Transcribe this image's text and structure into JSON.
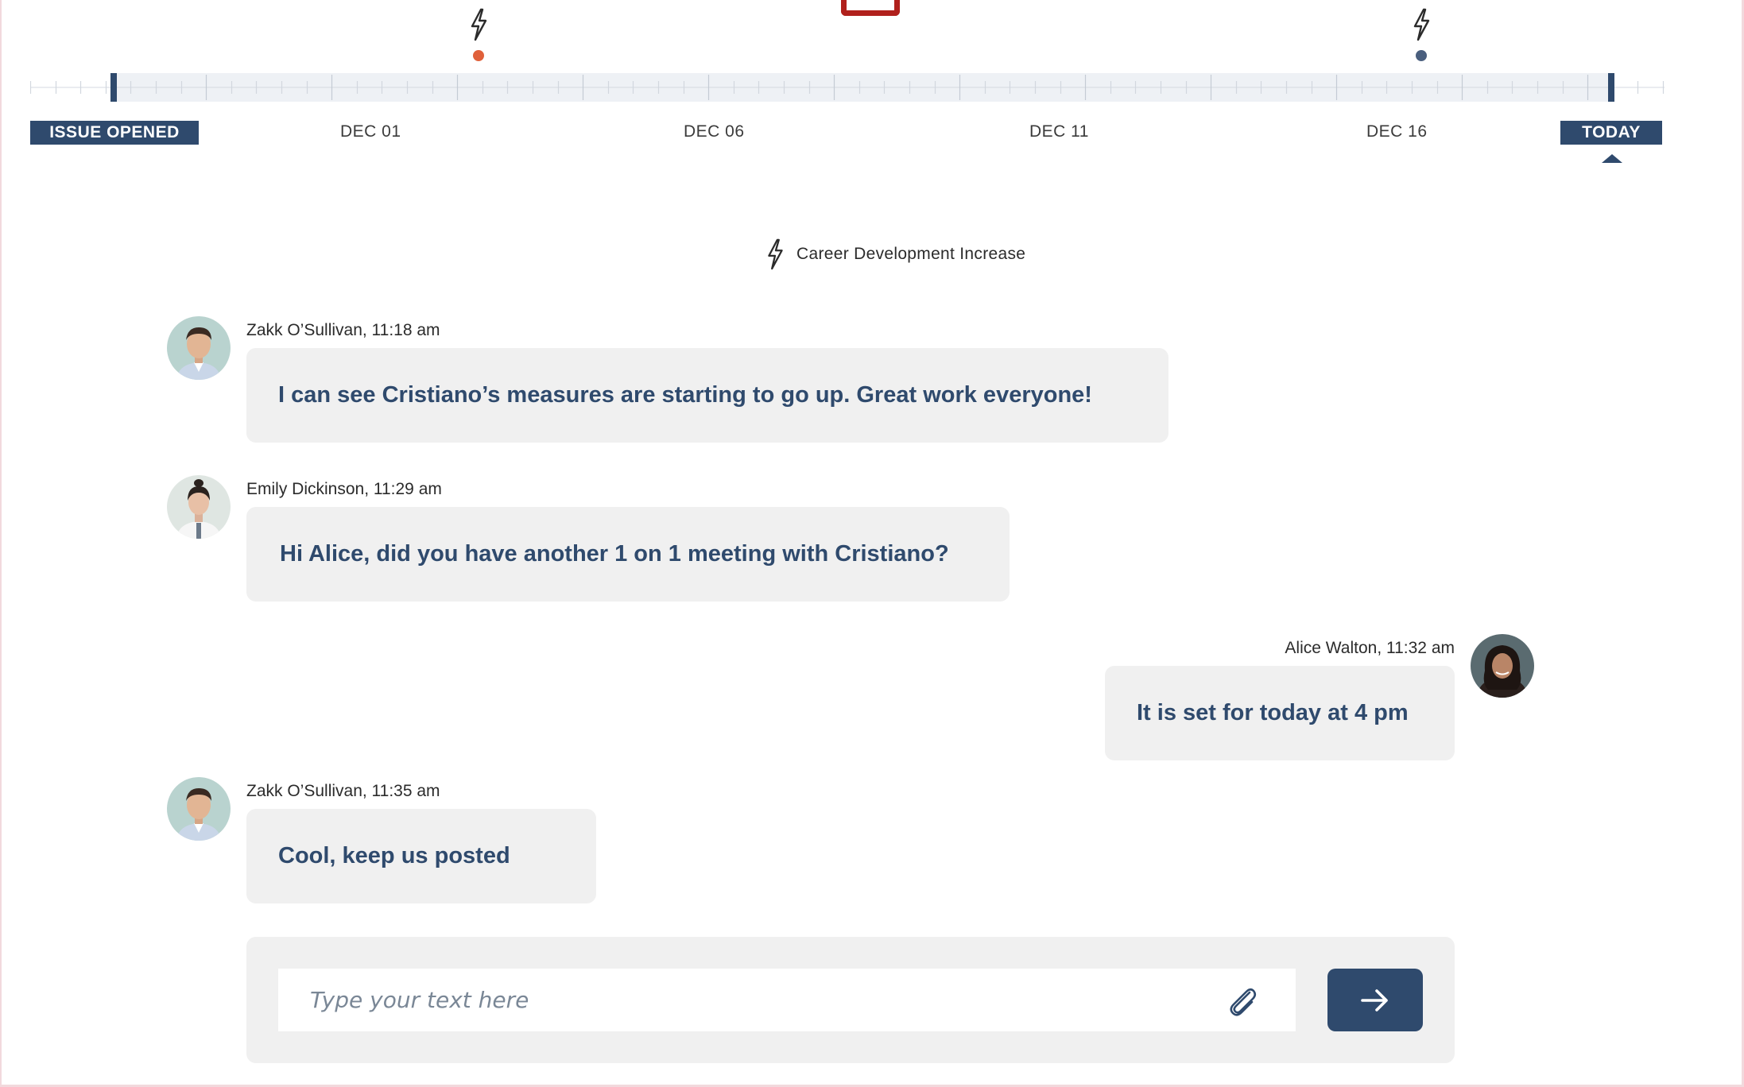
{
  "timeline": {
    "start_badge": "ISSUE OPENED",
    "end_badge": "TODAY",
    "dates": [
      "DEC 01",
      "DEC 06",
      "DEC 11",
      "DEC 16"
    ],
    "events": [
      {
        "icon": "bolt-icon",
        "color": "#e0603a"
      },
      {
        "icon": "bolt-icon",
        "color": "#4a5f7e"
      }
    ]
  },
  "event_heading": {
    "icon": "bolt-icon",
    "label": "Career Development Increase"
  },
  "messages": [
    {
      "author": "Zakk O’Sullivan, 11:18 am",
      "text": "I can see Cristiano’s measures are starting to go up. Great work everyone!",
      "side": "left"
    },
    {
      "author": "Emily Dickinson, 11:29 am",
      "text": "Hi Alice, did you have another 1 on 1 meeting with Cristiano?",
      "side": "left"
    },
    {
      "author": "Alice Walton, 11:32 am",
      "text": "It is set for today at 4 pm",
      "side": "right"
    },
    {
      "author": "Zakk O’Sullivan, 11:35 am",
      "text": "Cool, keep us posted",
      "side": "left"
    }
  ],
  "composer": {
    "placeholder": "Type your text here",
    "attach_icon": "paperclip-icon",
    "send_icon": "arrow-right-icon"
  },
  "colors": {
    "accent": "#2f4a6d",
    "bubble": "#f0f0f0",
    "event_orange": "#e0603a",
    "event_blue": "#4a5f7e",
    "top_marker": "#b0201c"
  }
}
